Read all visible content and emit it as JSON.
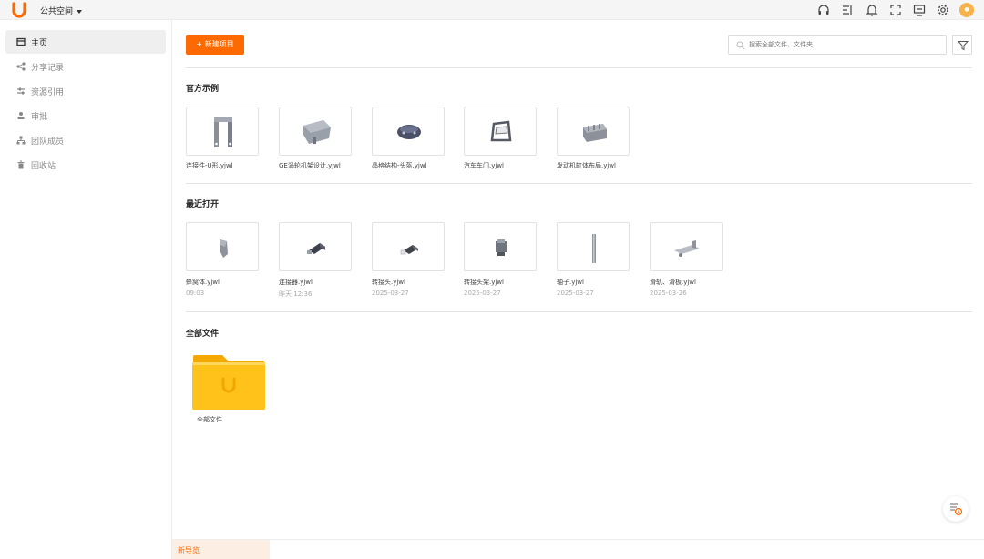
{
  "header": {
    "space_name": "公共空间"
  },
  "sidebar": {
    "items": [
      {
        "label": "主页",
        "icon": "home-icon",
        "active": true
      },
      {
        "label": "分享记录",
        "icon": "share-icon"
      },
      {
        "label": "资源引用",
        "icon": "resource-icon"
      },
      {
        "label": "审批",
        "icon": "user-icon"
      },
      {
        "label": "团队成员",
        "icon": "team-icon"
      },
      {
        "label": "回收站",
        "icon": "trash-icon"
      }
    ]
  },
  "toolbar": {
    "new_button": "+ 新建项目",
    "search_placeholder": "搜索全部文件、文件夹"
  },
  "sections": {
    "official": {
      "title": "官方示例",
      "items": [
        {
          "name": "连接件-U形.yjwl"
        },
        {
          "name": "GE涡轮机架设计.yjwl"
        },
        {
          "name": "晶格结构-头盔.yjwl"
        },
        {
          "name": "汽车车门.yjwl"
        },
        {
          "name": "发动机缸体布局.yjwl"
        }
      ]
    },
    "recent": {
      "title": "最近打开",
      "items": [
        {
          "name": "蜂窝体.yjwl",
          "date": "09:03"
        },
        {
          "name": "连接器.yjwl",
          "date": "昨天 12:36"
        },
        {
          "name": "转接头.yjwl",
          "date": "2025-03-27"
        },
        {
          "name": "转接头架.yjwl",
          "date": "2025-03-27"
        },
        {
          "name": "轴子.yjwl",
          "date": "2025-03-27"
        },
        {
          "name": "滑轨、滑板.yjwl",
          "date": "2025-03-26"
        }
      ]
    },
    "all": {
      "title": "全部文件",
      "folder_name": "全部文件"
    }
  },
  "bottom": {
    "tab_label": "新导览"
  },
  "colors": {
    "accent": "#ff6a00",
    "folder": "#ffc21a"
  }
}
